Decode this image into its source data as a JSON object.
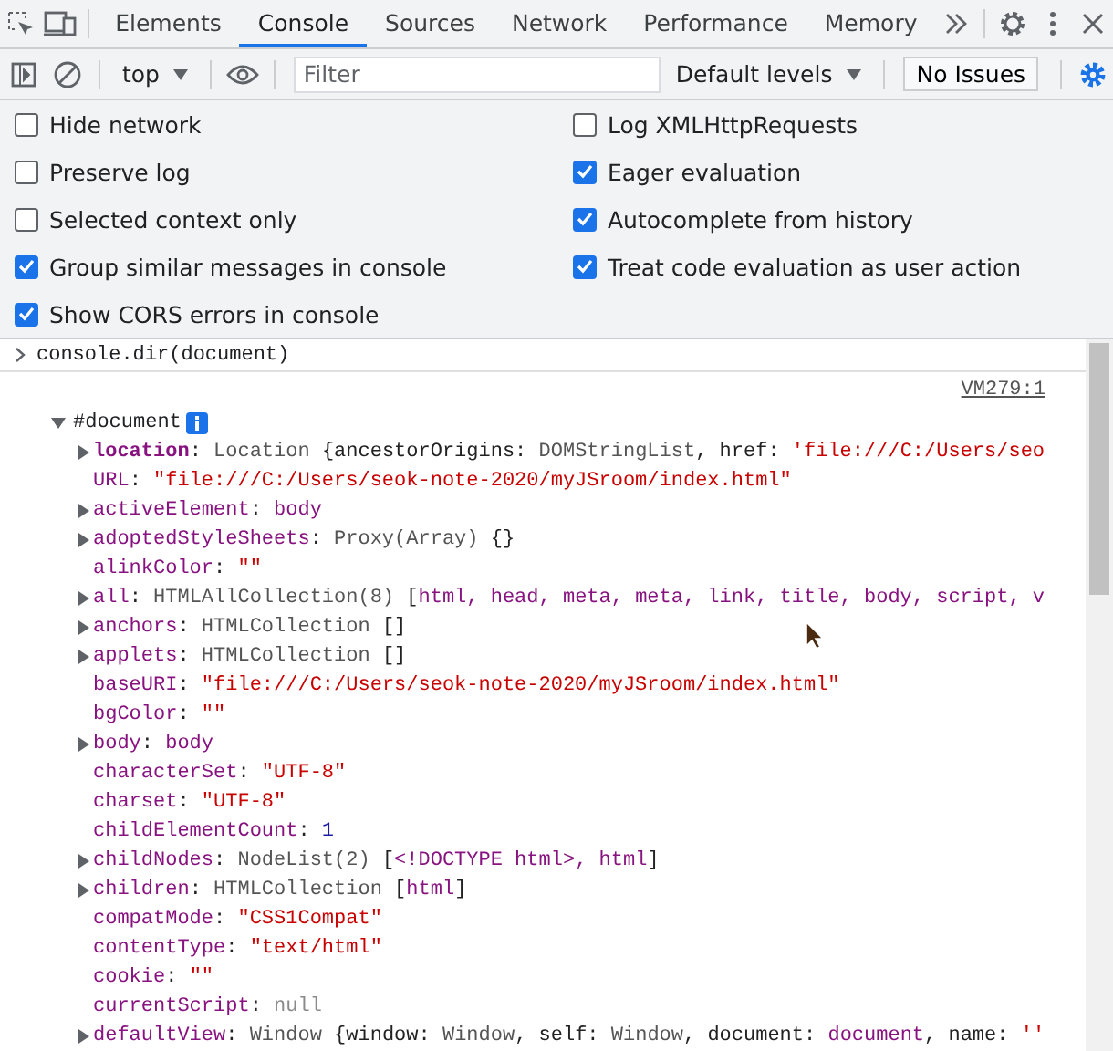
{
  "tabs": [
    {
      "label": "Elements",
      "selected": false
    },
    {
      "label": "Console",
      "selected": true
    },
    {
      "label": "Sources",
      "selected": false
    },
    {
      "label": "Network",
      "selected": false
    },
    {
      "label": "Performance",
      "selected": false
    },
    {
      "label": "Memory",
      "selected": false
    }
  ],
  "toolbar": {
    "context": "top",
    "filter": {
      "placeholder": "Filter"
    },
    "levels": "Default levels",
    "issues": "No Issues"
  },
  "settings": [
    {
      "label": "Hide network",
      "checked": false
    },
    {
      "label": "Log XMLHttpRequests",
      "checked": false
    },
    {
      "label": "Preserve log",
      "checked": false
    },
    {
      "label": "Eager evaluation",
      "checked": true
    },
    {
      "label": "Selected context only",
      "checked": false
    },
    {
      "label": "Autocomplete from history",
      "checked": true
    },
    {
      "label": "Group similar messages in console",
      "checked": true
    },
    {
      "label": "Treat code evaluation as user action",
      "checked": true
    },
    {
      "label": "Show CORS errors in console",
      "checked": true
    }
  ],
  "console": {
    "command": "console.dir(document)",
    "source_link": "VM279:1",
    "root": {
      "label": "#document",
      "expanded": true
    },
    "properties": [
      {
        "key": "location",
        "expandable": true,
        "bold": true,
        "value": [
          {
            "kind": "punct",
            "text": ": "
          },
          {
            "kind": "obj",
            "text": "Location "
          },
          {
            "kind": "punct",
            "text": "{ancestorOrigins: "
          },
          {
            "kind": "obj",
            "text": "DOMStringList"
          },
          {
            "kind": "punct",
            "text": ", href: "
          },
          {
            "kind": "str",
            "text": "'file:///C:/Users/seo"
          }
        ]
      },
      {
        "key": "URL",
        "expandable": false,
        "bold": false,
        "value": [
          {
            "kind": "punct",
            "text": ": "
          },
          {
            "kind": "str",
            "text": "\"file:///C:/Users/seok-note-2020/myJSroom/index.html\""
          }
        ]
      },
      {
        "key": "activeElement",
        "expandable": true,
        "bold": false,
        "value": [
          {
            "kind": "punct",
            "text": ": "
          },
          {
            "kind": "node",
            "text": "body"
          }
        ]
      },
      {
        "key": "adoptedStyleSheets",
        "expandable": true,
        "bold": false,
        "value": [
          {
            "kind": "punct",
            "text": ": "
          },
          {
            "kind": "obj",
            "text": "Proxy(Array) "
          },
          {
            "kind": "punct",
            "text": "{}"
          }
        ]
      },
      {
        "key": "alinkColor",
        "expandable": false,
        "bold": false,
        "value": [
          {
            "kind": "punct",
            "text": ": "
          },
          {
            "kind": "str",
            "text": "\"\""
          }
        ]
      },
      {
        "key": "all",
        "expandable": true,
        "bold": false,
        "value": [
          {
            "kind": "punct",
            "text": ": "
          },
          {
            "kind": "obj",
            "text": "HTMLAllCollection(8) "
          },
          {
            "kind": "punct",
            "text": "["
          },
          {
            "kind": "node",
            "text": "html, head, meta, meta, link, title, body, script, v"
          }
        ]
      },
      {
        "key": "anchors",
        "expandable": true,
        "bold": false,
        "value": [
          {
            "kind": "punct",
            "text": ": "
          },
          {
            "kind": "obj",
            "text": "HTMLCollection "
          },
          {
            "kind": "punct",
            "text": "[]"
          }
        ]
      },
      {
        "key": "applets",
        "expandable": true,
        "bold": false,
        "value": [
          {
            "kind": "punct",
            "text": ": "
          },
          {
            "kind": "obj",
            "text": "HTMLCollection "
          },
          {
            "kind": "punct",
            "text": "[]"
          }
        ]
      },
      {
        "key": "baseURI",
        "expandable": false,
        "bold": false,
        "value": [
          {
            "kind": "punct",
            "text": ": "
          },
          {
            "kind": "str",
            "text": "\"file:///C:/Users/seok-note-2020/myJSroom/index.html\""
          }
        ]
      },
      {
        "key": "bgColor",
        "expandable": false,
        "bold": false,
        "value": [
          {
            "kind": "punct",
            "text": ": "
          },
          {
            "kind": "str",
            "text": "\"\""
          }
        ]
      },
      {
        "key": "body",
        "expandable": true,
        "bold": false,
        "value": [
          {
            "kind": "punct",
            "text": ": "
          },
          {
            "kind": "node",
            "text": "body"
          }
        ]
      },
      {
        "key": "characterSet",
        "expandable": false,
        "bold": false,
        "value": [
          {
            "kind": "punct",
            "text": ": "
          },
          {
            "kind": "str",
            "text": "\"UTF-8\""
          }
        ]
      },
      {
        "key": "charset",
        "expandable": false,
        "bold": false,
        "value": [
          {
            "kind": "punct",
            "text": ": "
          },
          {
            "kind": "str",
            "text": "\"UTF-8\""
          }
        ]
      },
      {
        "key": "childElementCount",
        "expandable": false,
        "bold": false,
        "value": [
          {
            "kind": "punct",
            "text": ": "
          },
          {
            "kind": "num",
            "text": "1"
          }
        ]
      },
      {
        "key": "childNodes",
        "expandable": true,
        "bold": false,
        "value": [
          {
            "kind": "punct",
            "text": ": "
          },
          {
            "kind": "obj",
            "text": "NodeList(2) "
          },
          {
            "kind": "punct",
            "text": "["
          },
          {
            "kind": "node",
            "text": "<!DOCTYPE html>, html"
          },
          {
            "kind": "punct",
            "text": "]"
          }
        ]
      },
      {
        "key": "children",
        "expandable": true,
        "bold": false,
        "value": [
          {
            "kind": "punct",
            "text": ": "
          },
          {
            "kind": "obj",
            "text": "HTMLCollection "
          },
          {
            "kind": "punct",
            "text": "["
          },
          {
            "kind": "node",
            "text": "html"
          },
          {
            "kind": "punct",
            "text": "]"
          }
        ]
      },
      {
        "key": "compatMode",
        "expandable": false,
        "bold": false,
        "value": [
          {
            "kind": "punct",
            "text": ": "
          },
          {
            "kind": "str",
            "text": "\"CSS1Compat\""
          }
        ]
      },
      {
        "key": "contentType",
        "expandable": false,
        "bold": false,
        "value": [
          {
            "kind": "punct",
            "text": ": "
          },
          {
            "kind": "str",
            "text": "\"text/html\""
          }
        ]
      },
      {
        "key": "cookie",
        "expandable": false,
        "bold": false,
        "value": [
          {
            "kind": "punct",
            "text": ": "
          },
          {
            "kind": "str",
            "text": "\"\""
          }
        ]
      },
      {
        "key": "currentScript",
        "expandable": false,
        "bold": false,
        "value": [
          {
            "kind": "punct",
            "text": ": "
          },
          {
            "kind": "null",
            "text": "null"
          }
        ]
      },
      {
        "key": "defaultView",
        "expandable": true,
        "bold": false,
        "value": [
          {
            "kind": "punct",
            "text": ": "
          },
          {
            "kind": "obj",
            "text": "Window "
          },
          {
            "kind": "punct",
            "text": "{window: "
          },
          {
            "kind": "obj",
            "text": "Window"
          },
          {
            "kind": "punct",
            "text": ", self: "
          },
          {
            "kind": "obj",
            "text": "Window"
          },
          {
            "kind": "punct",
            "text": ", document: "
          },
          {
            "kind": "node",
            "text": "document"
          },
          {
            "kind": "punct",
            "text": ", name: "
          },
          {
            "kind": "str",
            "text": "''"
          }
        ]
      }
    ]
  }
}
